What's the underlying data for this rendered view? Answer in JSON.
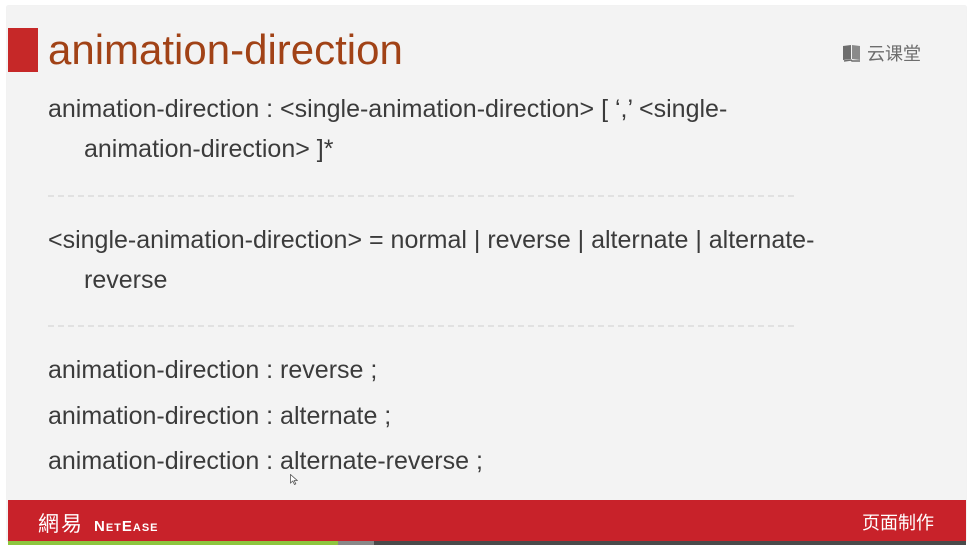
{
  "slide": {
    "title": "animation-direction",
    "brand_label": "云课堂",
    "lines": {
      "syntax_1": "animation-direction : <single-animation-direction> [   ‘,’   <single-",
      "syntax_2": "animation-direction> ]*",
      "values_1": "<single-animation-direction> = normal | reverse | alternate | alternate-",
      "values_2": "reverse",
      "example_1": "animation-direction : reverse ;",
      "example_2": "animation-direction : alternate ;",
      "example_3": "animation-direction : alternate-reverse ;"
    }
  },
  "footer": {
    "logo_cn": "網易",
    "logo_en": "NetEase",
    "section_label": "页面制作"
  },
  "progress": {
    "fraction": 0.345
  },
  "colors": {
    "accent_red": "#c8222a",
    "title_color": "#a14216",
    "progress_green": "#8dc63f"
  },
  "icons": [
    "book-icon",
    "cursor-icon"
  ]
}
